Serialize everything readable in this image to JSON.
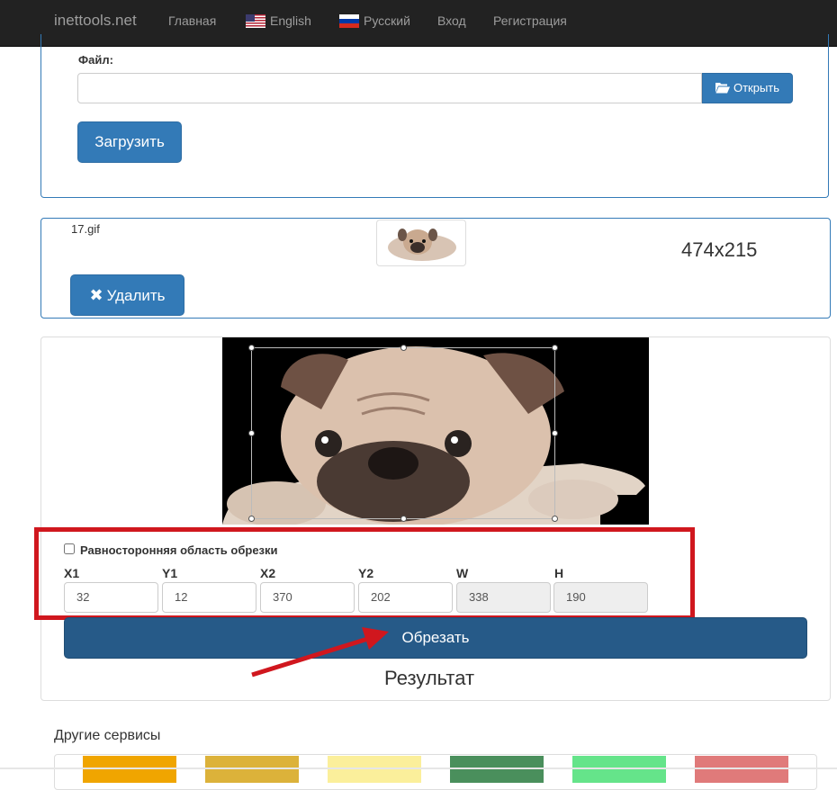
{
  "navbar": {
    "brand": "inettools.net",
    "home": "Главная",
    "english": "English",
    "russian": "Русский",
    "login": "Вход",
    "register": "Регистрация"
  },
  "upload": {
    "file_label": "Файл:",
    "file_value": "",
    "open_button": "Открыть",
    "upload_button": "Загрузить"
  },
  "file_item": {
    "name": "17.gif",
    "dimensions": "474x215",
    "delete_button": "Удалить"
  },
  "crop": {
    "square_label": "Равносторонняя область обрезки",
    "square_checked": false,
    "fields": [
      {
        "label": "X1",
        "value": "32",
        "readonly": false
      },
      {
        "label": "Y1",
        "value": "12",
        "readonly": false
      },
      {
        "label": "X2",
        "value": "370",
        "readonly": false
      },
      {
        "label": "Y2",
        "value": "202",
        "readonly": false
      },
      {
        "label": "W",
        "value": "338",
        "readonly": true
      },
      {
        "label": "H",
        "value": "190",
        "readonly": true
      }
    ],
    "crop_button": "Обрезать",
    "result_title": "Результат"
  },
  "other": {
    "title": "Другие сервисы",
    "tiles": [
      "#f0a500",
      "#dcb23a",
      "#fbef9b",
      "#4a8f5c",
      "#65e48a",
      "#e07a7a"
    ]
  },
  "colors": {
    "navbar": "#222222",
    "primary": "#337ab7",
    "primary_dark": "#265a88",
    "highlight": "#d0171e"
  }
}
